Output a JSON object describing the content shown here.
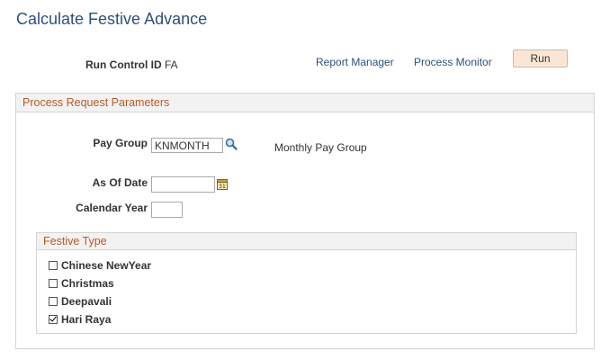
{
  "page": {
    "title": "Calculate Festive Advance"
  },
  "run_control": {
    "label": "Run Control ID",
    "value": "FA"
  },
  "links": {
    "report_manager": "Report Manager",
    "process_monitor": "Process Monitor"
  },
  "run_button": {
    "label": "Run"
  },
  "params": {
    "header": "Process Request Parameters",
    "pay_group": {
      "label": "Pay Group",
      "value": "KNMONTH",
      "description": "Monthly Pay Group"
    },
    "as_of_date": {
      "label": "As Of Date",
      "value": ""
    },
    "calendar_year": {
      "label": "Calendar Year",
      "value": ""
    }
  },
  "festive_type": {
    "header": "Festive Type",
    "options": [
      {
        "label": "Chinese NewYear",
        "checked": false
      },
      {
        "label": "Christmas",
        "checked": false
      },
      {
        "label": "Deepavali",
        "checked": false
      },
      {
        "label": "Hari Raya",
        "checked": true
      }
    ]
  },
  "icons": {
    "lookup": "search-icon",
    "calendar": "calendar-icon"
  },
  "colors": {
    "title": "#2e4f7c",
    "section_header": "#b55a24",
    "run_button_bg": "#fbe6d6"
  }
}
